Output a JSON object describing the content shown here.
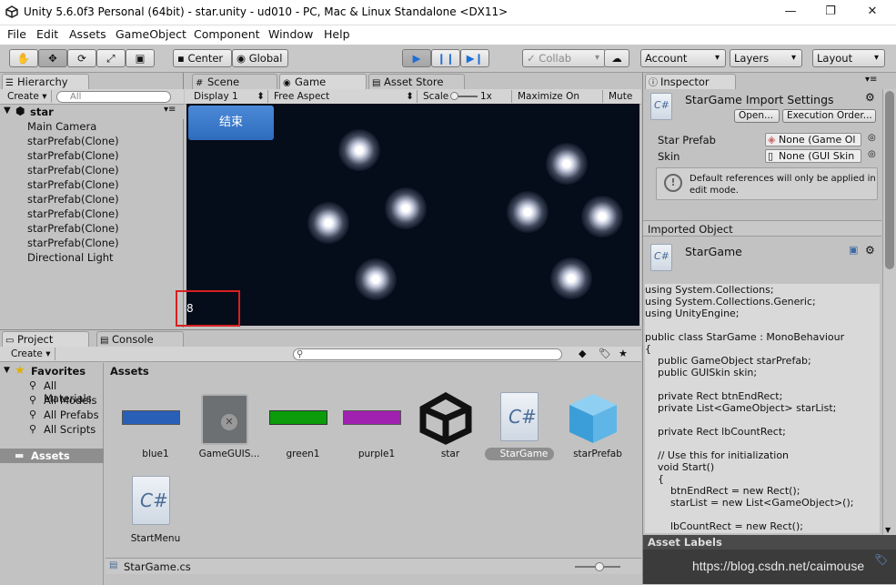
{
  "window": {
    "title": "Unity 5.6.0f3 Personal (64bit) - star.unity - ud010 - PC, Mac & Linux Standalone <DX11>"
  },
  "menu": [
    "File",
    "Edit",
    "Assets",
    "GameObject",
    "Component",
    "Window",
    "Help"
  ],
  "toolbar": {
    "center_label": "Center",
    "global_label": "Global",
    "collab_label": "Collab",
    "account_label": "Account",
    "layers_label": "Layers",
    "layout_label": "Layout"
  },
  "hierarchy": {
    "tab_label": "Hierarchy",
    "create_label": "Create",
    "search_placeholder": "All",
    "scene_name": "star",
    "items": [
      "Main Camera",
      "starPrefab(Clone)",
      "starPrefab(Clone)",
      "starPrefab(Clone)",
      "starPrefab(Clone)",
      "starPrefab(Clone)",
      "starPrefab(Clone)",
      "starPrefab(Clone)",
      "starPrefab(Clone)",
      "Directional Light"
    ]
  },
  "center_tabs": {
    "scene": "Scene",
    "game": "Game",
    "asset_store": "Asset Store"
  },
  "game_bar": {
    "display": "Display 1",
    "aspect": "Free Aspect",
    "scale_label": "Scale",
    "scale_value": "1x",
    "maximize": "Maximize On Play",
    "mute": "Mute A"
  },
  "game": {
    "end_button": "结束",
    "count": "8"
  },
  "project": {
    "tab_label": "Project",
    "console_label": "Console",
    "create_label": "Create",
    "favorites_label": "Favorites",
    "favorites": [
      "All Materials",
      "All Models",
      "All Prefabs",
      "All Scripts"
    ],
    "assets_tree_label": "Assets",
    "assets_header": "Assets",
    "assets": [
      "blue1",
      "GameGUIS...",
      "green1",
      "purple1",
      "star",
      "StarGame",
      "starPrefab",
      "StartMenu"
    ],
    "selected_file": "StarGame.cs",
    "colors": {
      "blue1": "#2a5fb8",
      "green1": "#0a9c0a",
      "purple1": "#a020b0"
    }
  },
  "inspector": {
    "tab_label": "Inspector",
    "title": "StarGame Import Settings",
    "open_label": "Open...",
    "exec_order_label": "Execution Order...",
    "star_prefab_label": "Star Prefab",
    "star_prefab_value": "None (Game Ol",
    "skin_label": "Skin",
    "skin_value": "None (GUI Skin",
    "help_text_1": "Default references will only be applied in",
    "help_text_2": "edit mode.",
    "imported_object_label": "Imported Object",
    "object_name": "StarGame",
    "code": "using System.Collections;\nusing System.Collections.Generic;\nusing UnityEngine;\n\npublic class StarGame : MonoBehaviour\n{\n    public GameObject starPrefab;\n    public GUISkin skin;\n\n    private Rect btnEndRect;\n    private List<GameObject> starList;\n\n    private Rect lbCountRect;\n\n    // Use this for initialization\n    void Start()\n    {\n        btnEndRect = new Rect();\n        starList = new List<GameObject>();\n\n        lbCountRect = new Rect();",
    "asset_labels": "Asset Labels"
  },
  "watermark": "https://blog.csdn.net/caimouse"
}
